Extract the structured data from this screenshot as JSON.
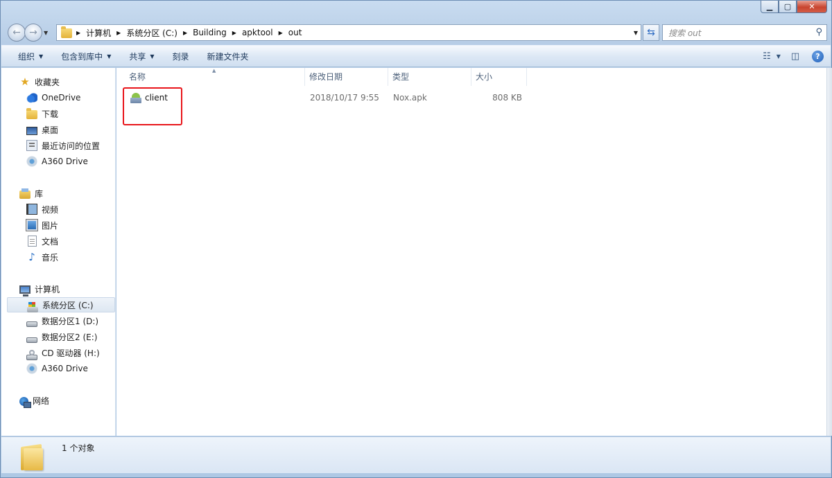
{
  "address": {
    "crumbs": [
      "计算机",
      "系统分区 (C:)",
      "Building",
      "apktool",
      "out"
    ]
  },
  "search": {
    "placeholder": "搜索 out"
  },
  "toolbar": {
    "organize": "组织",
    "include_in_library": "包含到库中",
    "share": "共享",
    "burn": "刻录",
    "new_folder": "新建文件夹",
    "help": "?"
  },
  "nav": {
    "favorites": {
      "label": "收藏夹",
      "items": [
        "OneDrive",
        "下载",
        "桌面",
        "最近访问的位置",
        "A360 Drive"
      ]
    },
    "libraries": {
      "label": "库",
      "items": [
        "视频",
        "图片",
        "文档",
        "音乐"
      ]
    },
    "computer": {
      "label": "计算机",
      "items": [
        "系统分区 (C:)",
        "数据分区1 (D:)",
        "数据分区2 (E:)",
        "CD 驱动器 (H:)",
        "A360 Drive"
      ],
      "selected": "系统分区 (C:)"
    },
    "network": {
      "label": "网络"
    }
  },
  "columns": {
    "name": "名称",
    "modified": "修改日期",
    "type": "类型",
    "size": "大小"
  },
  "files": [
    {
      "name": "client",
      "modified": "2018/10/17 9:55",
      "type": "Nox.apk",
      "size": "808 KB"
    }
  ],
  "status": {
    "count": "1 个对象"
  },
  "colors": {
    "highlight_box": "#e8141a",
    "window_frame": "#b9d1ea",
    "column_header_text": "#4c607a"
  }
}
